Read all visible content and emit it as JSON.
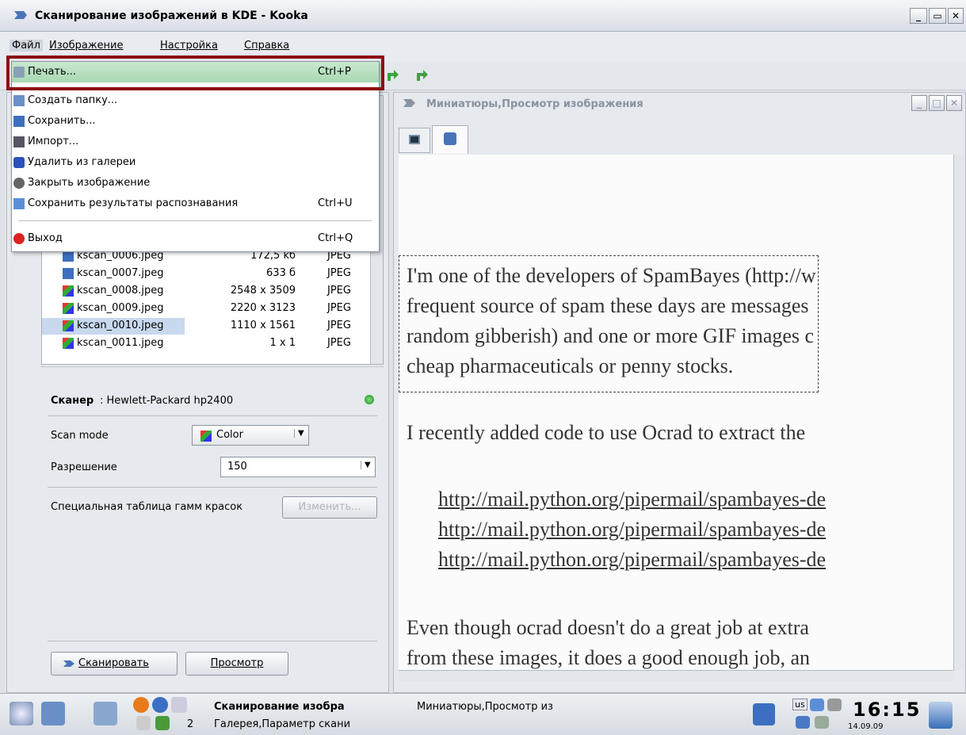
{
  "window": {
    "title": "Сканирование изображений в KDE - Kooka",
    "btn_min": "_",
    "btn_max": "▭",
    "btn_close": "✕"
  },
  "menubar": {
    "file": "Файл",
    "image": "Изображение",
    "settings": "Настройка",
    "help": "Справка"
  },
  "file_menu": {
    "items": [
      {
        "label": "Печать...",
        "shortcut": "Ctrl+P"
      },
      {
        "label": "Создать папку...",
        "shortcut": ""
      },
      {
        "label": "Сохранить...",
        "shortcut": ""
      },
      {
        "label": "Импорт...",
        "shortcut": ""
      },
      {
        "label": "Удалить из галереи",
        "shortcut": ""
      },
      {
        "label": "Закрыть изображение",
        "shortcut": ""
      },
      {
        "label": "Сохранить результаты распознавания",
        "shortcut": "Ctrl+U"
      },
      {
        "label": "Выход",
        "shortcut": "Ctrl+Q"
      }
    ]
  },
  "gallery": {
    "rows": [
      {
        "name": "kscan_0006.jpeg",
        "size": "172,5 kб",
        "type": "JPEG"
      },
      {
        "name": "kscan_0007.jpeg",
        "size": "633 б",
        "type": "JPEG"
      },
      {
        "name": "kscan_0008.jpeg",
        "size": "2548 x 3509",
        "type": "JPEG"
      },
      {
        "name": "kscan_0009.jpeg",
        "size": "2220 x 3123",
        "type": "JPEG"
      },
      {
        "name": "kscan_0010.jpeg",
        "size": "1110 x 1561",
        "type": "JPEG"
      },
      {
        "name": "kscan_0011.jpeg",
        "size": "1 x 1",
        "type": "JPEG"
      }
    ]
  },
  "scanner": {
    "label": "Сканер",
    "device": ": Hewlett-Packard hp2400",
    "scan_mode_label": "Scan mode",
    "scan_mode_value": "Color",
    "resolution_label": "Разрешение",
    "resolution_value": "150",
    "gamma_label": "Специальная таблица гамм красок",
    "gamma_button": "Изменить...",
    "scan_button": "Сканировать",
    "preview_button": "Просмотр"
  },
  "viewer": {
    "title": "Миниатюры,Просмотр изображения",
    "lines": [
      "I'm one of the developers of SpamBayes (http://w",
      "frequent source of spam these days are messages",
      "random gibberish) and one or more GIF images c",
      "cheap pharmaceuticals or penny stocks.",
      "I recently added code to use Ocrad to extract the",
      "http://mail.python.org/pipermail/spambayes-de",
      "http://mail.python.org/pipermail/spambayes-de",
      "http://mail.python.org/pipermail/spambayes-de",
      "Even though ocrad doesn't do a great job at extra",
      "from these images, it does a good enough job, an"
    ]
  },
  "taskbar": {
    "desktop_num": "2",
    "task1": "Сканирование изобра",
    "task2": "Миниатюры,Просмотр из",
    "task3": "Галерея,Параметр скани",
    "kbd": "us",
    "clock": "16:15",
    "date": "14.09.09"
  }
}
